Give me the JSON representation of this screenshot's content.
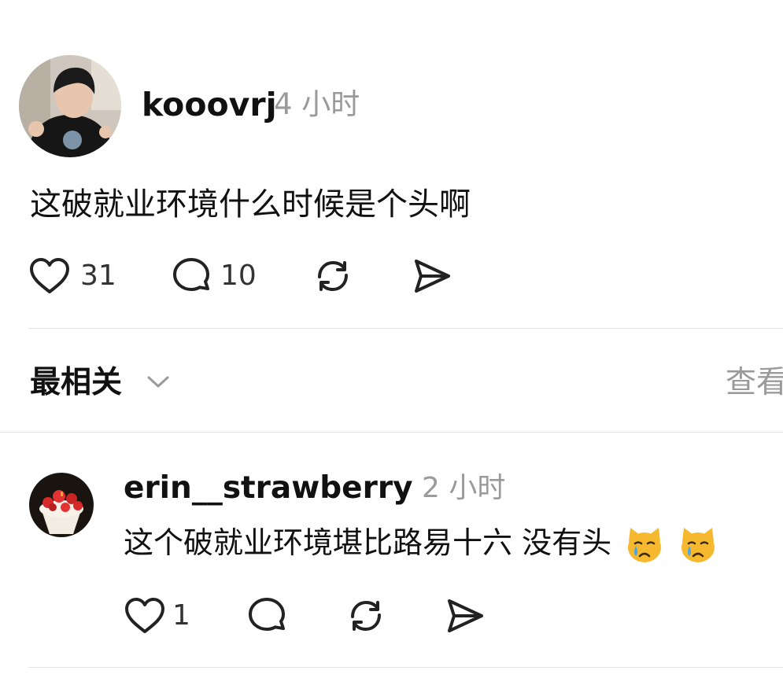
{
  "post": {
    "username": "kooovrj",
    "timestamp": "4 小时",
    "text": "这破就业环境什么时候是个头啊",
    "likes": "31",
    "comments": "10",
    "icons": {
      "like": "heart-icon",
      "comment": "comment-bubble-icon",
      "repost": "repost-icon",
      "share": "send-icon"
    }
  },
  "sort_bar": {
    "label": "最相关",
    "right_text": "查看"
  },
  "reply": {
    "username": "erin__strawberry",
    "timestamp": "2 小时",
    "text": "这个破就业环境堪比路易十六 没有头",
    "emoji": [
      "crying-cat-face",
      "crying-cat-face"
    ],
    "likes": "1"
  },
  "colors": {
    "text_primary": "#111111",
    "text_secondary": "#9a9a9a",
    "divider": "#e4e4e4",
    "emoji_yellow": "#f5b82e"
  }
}
